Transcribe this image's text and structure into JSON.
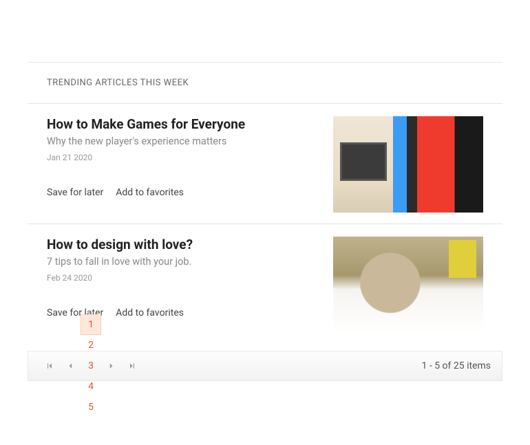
{
  "section": {
    "heading": "TRENDING ARTICLES THIS WEEK"
  },
  "articles": [
    {
      "title": "How to Make Games for Everyone",
      "subtitle": "Why the new player's experience matters",
      "date": "Jan 21 2020",
      "save_label": "Save for later",
      "favorite_label": "Add to favorites",
      "thumb_name": "article-thumbnail-joycons"
    },
    {
      "title": "How to design with love?",
      "subtitle": "7 tips to fall in love with your job.",
      "date": "Feb 24 2020",
      "save_label": "Save for later",
      "favorite_label": "Add to favorites",
      "thumb_name": "article-thumbnail-drawing"
    }
  ],
  "pager": {
    "pages": [
      "1",
      "2",
      "3",
      "4",
      "5"
    ],
    "selected_index": 0,
    "status": "1 - 5 of 25 items"
  }
}
